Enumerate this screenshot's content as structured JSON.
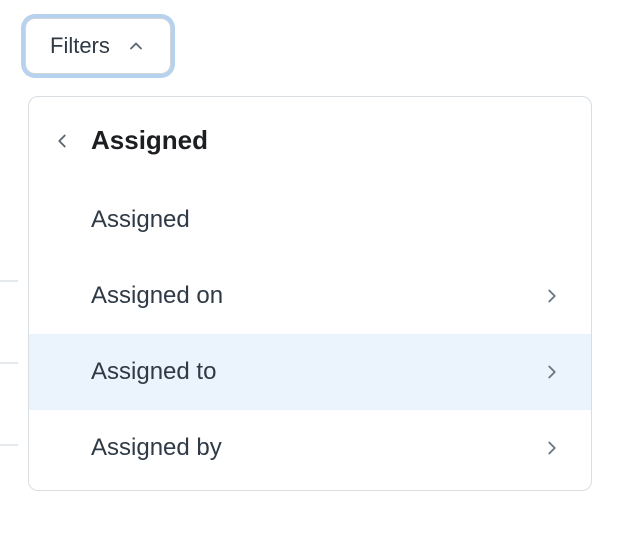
{
  "button": {
    "label": "Filters"
  },
  "panel": {
    "title": "Assigned",
    "items": [
      {
        "label": "Assigned",
        "has_chevron": false,
        "hovered": false
      },
      {
        "label": "Assigned on",
        "has_chevron": true,
        "hovered": false
      },
      {
        "label": "Assigned to",
        "has_chevron": true,
        "hovered": true
      },
      {
        "label": "Assigned by",
        "has_chevron": true,
        "hovered": false
      }
    ]
  }
}
